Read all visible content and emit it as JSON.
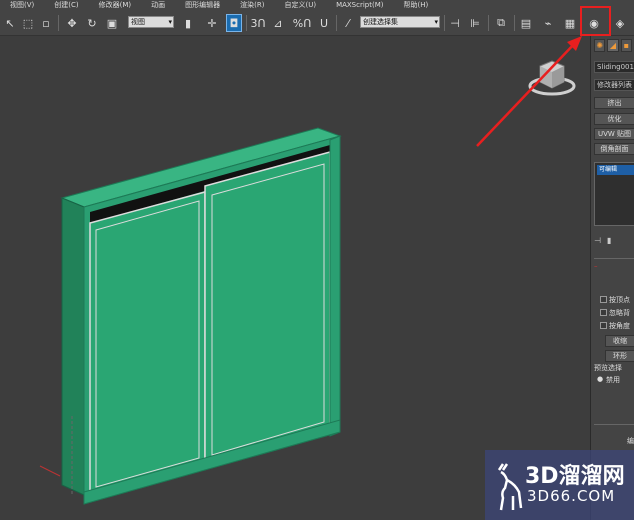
{
  "menu": [
    "视图(V)",
    "创建(C)",
    "修改器(M)",
    "动画",
    "图形编辑器",
    "渲染(R)",
    "自定义(U)",
    "MAXScript(M)",
    "帮助(H)"
  ],
  "toolbar": {
    "view_dropdown": "视图",
    "selection_set_dropdown": "创建选择集",
    "snap_label": "3",
    "percent_snap_label": "%"
  },
  "command_panel": {
    "object_name": "Sliding001",
    "modifier_list": "修改器列表",
    "buttons": [
      "挤出",
      "优化",
      "UVW 贴图",
      "倒角剖面"
    ],
    "stack_item": "可编辑",
    "checkboxes": [
      "按顶点",
      "忽略背",
      "按角度"
    ],
    "shrink_button": "收缩",
    "ring_button": "环形",
    "soft_selection_label": "预览选择",
    "disable_label": "禁用",
    "bottom_label": "编"
  },
  "watermark": {
    "title": "3D溜溜网",
    "subtitle": "3D66.COM"
  },
  "colors": {
    "accent": "#1a6cb0",
    "highlight": "#e81f1f",
    "door": "#2a9f72",
    "viewport_bg": "#3d3d3d"
  }
}
